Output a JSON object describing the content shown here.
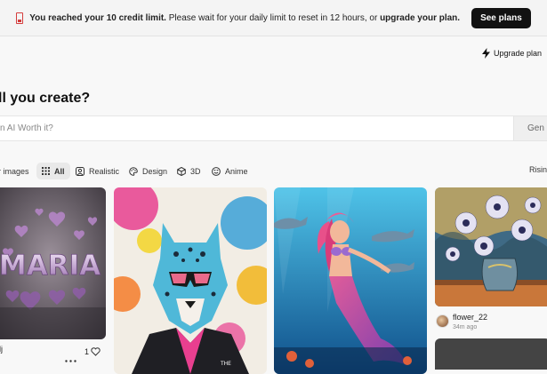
{
  "banner": {
    "bold_text": "You reached your 10 credit limit.",
    "rest_text": "Please wait for your daily limit to reset in 12 hours, or",
    "link_text": "upgrade your plan.",
    "button": "See plans"
  },
  "header": {
    "upgrade_label": "Upgrade plan"
  },
  "main": {
    "heading": "ll you create?",
    "prompt_placeholder": "n AI Worth it?",
    "generate_label": "Gen"
  },
  "filters": {
    "items": [
      {
        "label": "r images",
        "icon": "image-icon",
        "active": false
      },
      {
        "label": "All",
        "icon": "grid-icon",
        "active": true
      },
      {
        "label": "Realistic",
        "icon": "portrait-icon",
        "active": false
      },
      {
        "label": "Design",
        "icon": "palette-icon",
        "active": false
      },
      {
        "label": "3D",
        "icon": "cube-icon",
        "active": false
      },
      {
        "label": "Anime",
        "icon": "smiley-icon",
        "active": false
      }
    ],
    "sort_label": "Risin"
  },
  "gallery": [
    {
      "name": "maria-text-art",
      "footer_text": "dj",
      "likes": "1"
    },
    {
      "name": "leopard-sunglasses",
      "footer_text": ""
    },
    {
      "name": "mermaid-dolphins",
      "footer_text": ""
    },
    {
      "name": "flowers-vase",
      "user": "flower_22",
      "time": "34m ago"
    }
  ],
  "card_art": {
    "maria_text": "MARIA",
    "shirt_text": "THE"
  }
}
